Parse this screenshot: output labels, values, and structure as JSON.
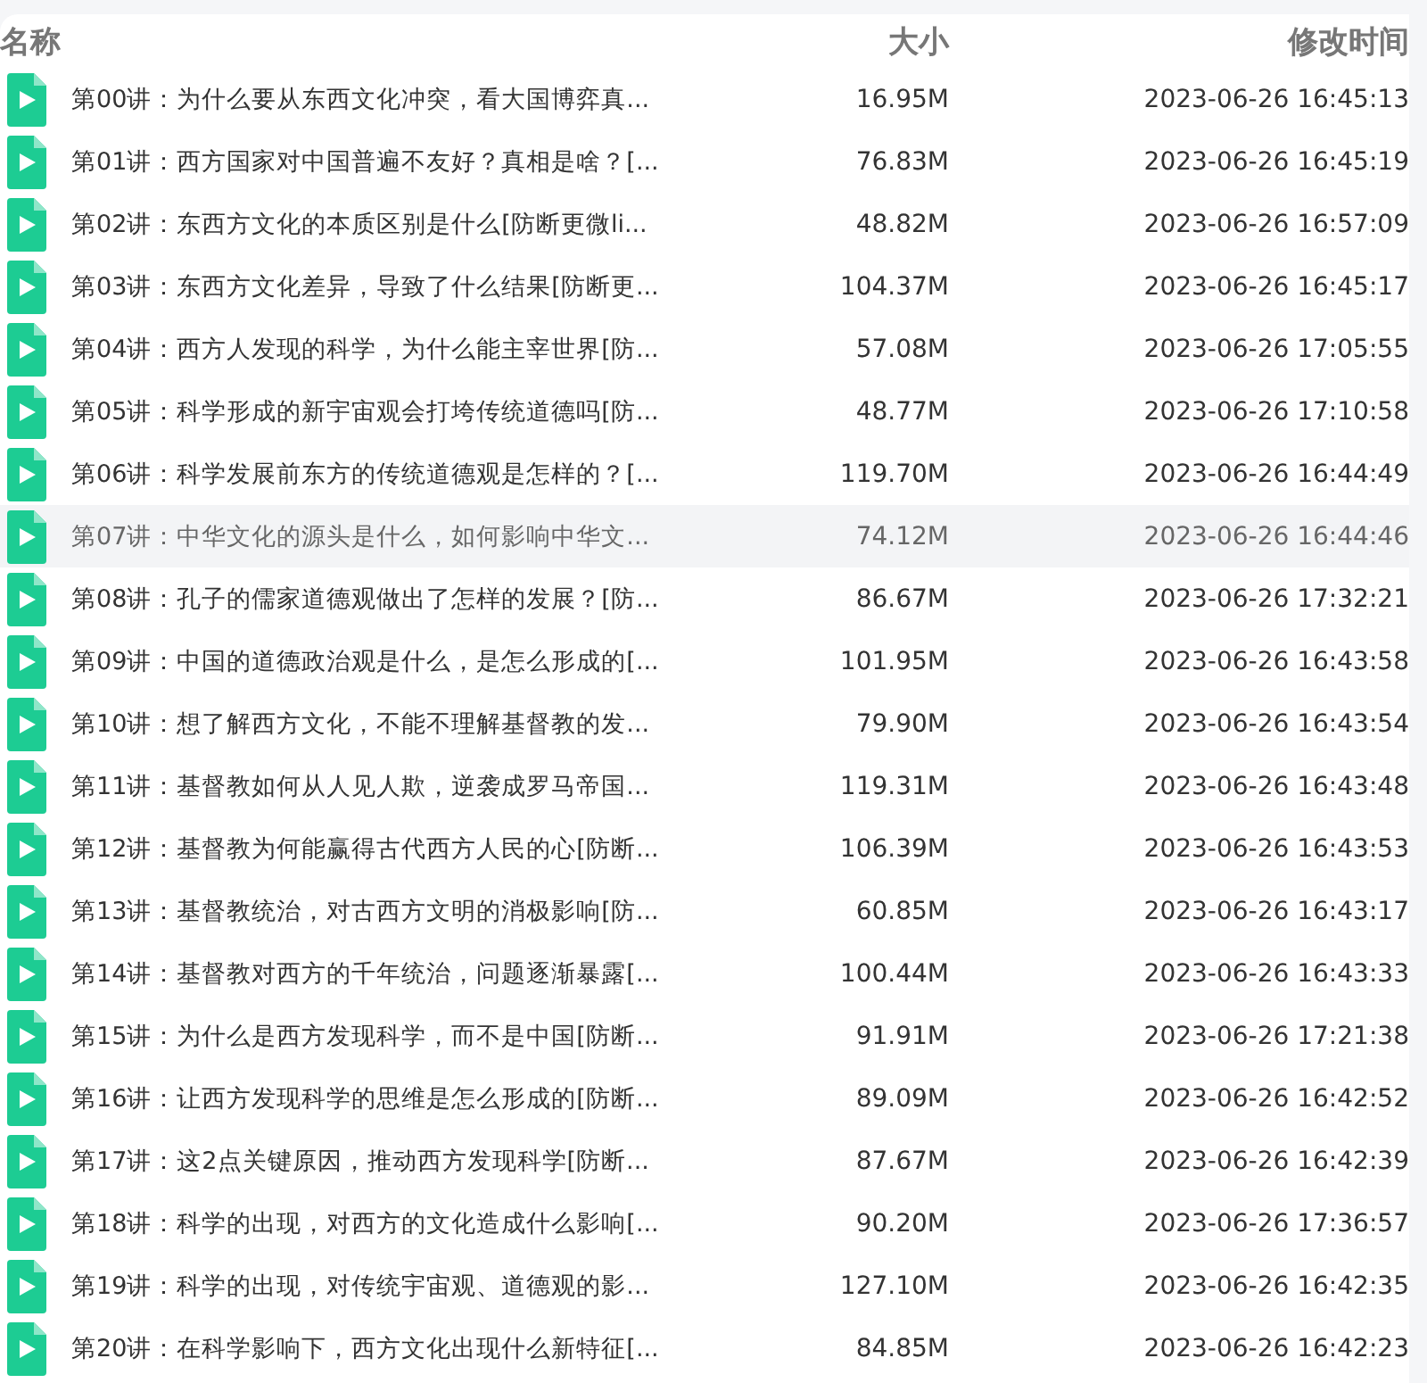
{
  "table": {
    "columns": [
      "名称",
      "大小",
      "修改时间"
    ],
    "rows": [
      {
        "name": "第00讲：为什么要从东西文化冲突，看大国博弈真...",
        "size": "16.95M",
        "modified": "2023-06-26 16:45:13",
        "selected": false
      },
      {
        "name": "第01讲：西方国家对中国普遍不友好？真相是啥？[...",
        "size": "76.83M",
        "modified": "2023-06-26 16:45:19",
        "selected": false
      },
      {
        "name": "第02讲：东西方文化的本质区别是什么[防断更微li...",
        "size": "48.82M",
        "modified": "2023-06-26 16:57:09",
        "selected": false
      },
      {
        "name": "第03讲：东西方文化差异，导致了什么结果[防断更...",
        "size": "104.37M",
        "modified": "2023-06-26 16:45:17",
        "selected": false
      },
      {
        "name": "第04讲：西方人发现的科学，为什么能主宰世界[防...",
        "size": "57.08M",
        "modified": "2023-06-26 17:05:55",
        "selected": false
      },
      {
        "name": "第05讲：科学形成的新宇宙观会打垮传统道德吗[防...",
        "size": "48.77M",
        "modified": "2023-06-26 17:10:58",
        "selected": false
      },
      {
        "name": "第06讲：科学发展前东方的传统道德观是怎样的？[...",
        "size": "119.70M",
        "modified": "2023-06-26 16:44:49",
        "selected": false
      },
      {
        "name": "第07讲：中华文化的源头是什么，如何影响中华文...",
        "size": "74.12M",
        "modified": "2023-06-26 16:44:46",
        "selected": true
      },
      {
        "name": "第08讲：孔子的儒家道德观做出了怎样的发展？[防...",
        "size": "86.67M",
        "modified": "2023-06-26 17:32:21",
        "selected": false
      },
      {
        "name": "第09讲：中国的道德政治观是什么，是怎么形成的[...",
        "size": "101.95M",
        "modified": "2023-06-26 16:43:58",
        "selected": false
      },
      {
        "name": "第10讲：想了解西方文化，不能不理解基督教的发...",
        "size": "79.90M",
        "modified": "2023-06-26 16:43:54",
        "selected": false
      },
      {
        "name": "第11讲：基督教如何从人见人欺，逆袭成罗马帝国...",
        "size": "119.31M",
        "modified": "2023-06-26 16:43:48",
        "selected": false
      },
      {
        "name": "第12讲：基督教为何能赢得古代西方人民的心[防断...",
        "size": "106.39M",
        "modified": "2023-06-26 16:43:53",
        "selected": false
      },
      {
        "name": "第13讲：基督教统治，对古西方文明的消极影响[防...",
        "size": "60.85M",
        "modified": "2023-06-26 16:43:17",
        "selected": false
      },
      {
        "name": "第14讲：基督教对西方的千年统治，问题逐渐暴露[...",
        "size": "100.44M",
        "modified": "2023-06-26 16:43:33",
        "selected": false
      },
      {
        "name": "第15讲：为什么是西方发现科学，而不是中国[防断...",
        "size": "91.91M",
        "modified": "2023-06-26 17:21:38",
        "selected": false
      },
      {
        "name": "第16讲：让西方发现科学的思维是怎么形成的[防断...",
        "size": "89.09M",
        "modified": "2023-06-26 16:42:52",
        "selected": false
      },
      {
        "name": "第17讲：这2点关键原因，推动西方发现科学[防断...",
        "size": "87.67M",
        "modified": "2023-06-26 16:42:39",
        "selected": false
      },
      {
        "name": "第18讲：科学的出现，对西方的文化造成什么影响[...",
        "size": "90.20M",
        "modified": "2023-06-26 17:36:57",
        "selected": false
      },
      {
        "name": "第19讲：科学的出现，对传统宇宙观、道德观的影...",
        "size": "127.10M",
        "modified": "2023-06-26 16:42:35",
        "selected": false
      },
      {
        "name": "第20讲：在科学影响下，西方文化出现什么新特征[...",
        "size": "84.85M",
        "modified": "2023-06-26 16:42:23",
        "selected": false
      }
    ]
  }
}
